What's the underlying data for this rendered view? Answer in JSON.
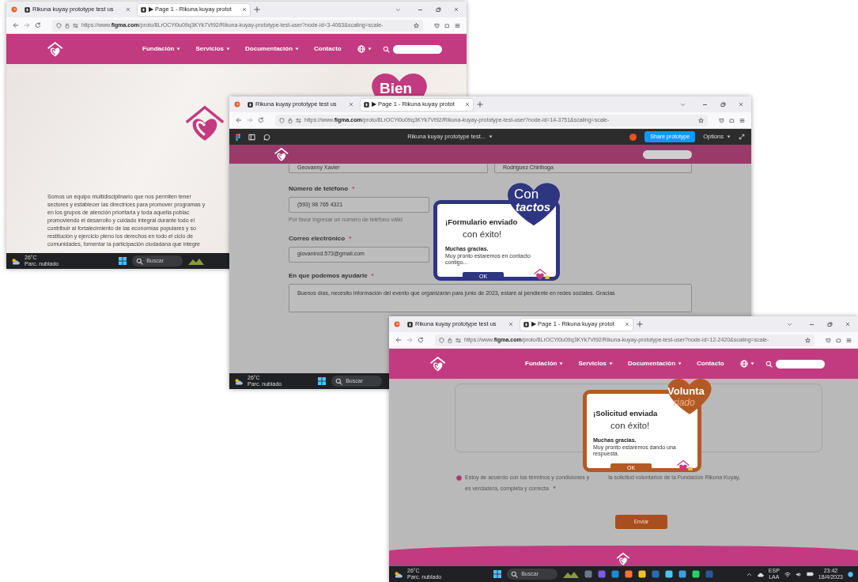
{
  "windows": [
    {
      "kind": "home",
      "tabs": [
        {
          "label": "Rikuna kuyay prototype test us",
          "selected": false
        },
        {
          "label": "▶ Page 1 - Rikuna kuyay protot",
          "selected": true
        }
      ],
      "url": "https://www.**figma.com**/proto/8LrOCYi0u09q3KYk7Vt92/Rikuna-kuyay-prototype-test-user?node-id=3-4063&scaling=scale-",
      "nav": [
        {
          "label": "Fundación",
          "dropdown": true
        },
        {
          "label": "Servicios",
          "dropdown": true
        },
        {
          "label": "Documentación",
          "dropdown": true
        },
        {
          "label": "Contacto",
          "dropdown": false
        }
      ],
      "hero": {
        "badge": "Bien",
        "paragraph": "Somos un equipo multidisciplinario que nos permiten tener\nsectores y establecer las directrices para promover programas y\nen los grupos de atención prioritaria y toda aquella poblac\npromoviendo el desarrollo y cuidado integral durante todo el\ncontribuir al fortalecimiento de las economías populares y so\nrestitución y ejercicio pleno los derechos en todo el ciclo de\ncomunidades, fomentar la participación ciudadana que integre"
      },
      "taskbar": {
        "temperature": "26°C",
        "weather": "Parc. nublado",
        "search": "Buscar"
      }
    },
    {
      "kind": "contact",
      "tabs": [
        {
          "label": "Rikuna kuyay prototype test us",
          "selected": false
        },
        {
          "label": "▶ Page 1 - Rikuna kuyay protot",
          "selected": true
        }
      ],
      "url": "https://www.**figma.com**/proto/8LrOCYi0u09q3KYk7Vt92/Rikuna-kuyay-prototype-test-user?node-id=14-3751&scaling=scale-",
      "figma_bar": {
        "title": "Rikuna kuyay prototype test...",
        "share": "Share prototype",
        "options": "Options"
      },
      "form": {
        "first_name": "Geovanny Xavier",
        "last_name": "Rodriguez Chiriboga",
        "fields": [
          {
            "kind": "input",
            "label": "Número de teléfono",
            "required_mark": "*",
            "value": "(593) 98 765 4321",
            "hint": "Por favor ingresar un número de teléfono válid"
          },
          {
            "kind": "input",
            "label": "Correo electrónico",
            "required_mark": "*",
            "value": "giovanirod.573@gmail.com"
          },
          {
            "kind": "textarea",
            "label": "En que podemos ayudarle",
            "required_mark": "*",
            "value": "Buenos días, necesito información del evento que organizarán para junio de 2023, estaré al pendiente en redes sociales. Gracias"
          }
        ]
      },
      "dialog": {
        "badge": [
          "Con",
          "tactos"
        ],
        "title": "¡Formulario enviado",
        "subtitle": "con éxito!",
        "thanks": "Muchas gracias.",
        "message": "Muy pronto estaremos en contacto contigo...",
        "button": "OK",
        "color": "#2e3581"
      },
      "taskbar": {
        "temperature": "26°C",
        "weather": "Parc. nublado",
        "search": "Buscar"
      }
    },
    {
      "kind": "volunteer",
      "tabs": [
        {
          "label": "Rikuna kuyay prototype test us",
          "selected": false
        },
        {
          "label": "▶ Page 1 - Rikuna kuyay protot",
          "selected": true
        }
      ],
      "url": "https://www.**figma.com**/proto/8LrOCYi0u09q3KYk7Vt92/Rikuna-kuyay-prototype-test-user?node-id=12-2420&scaling=scale-",
      "nav": [
        {
          "label": "Fundación",
          "dropdown": true
        },
        {
          "label": "Servicios",
          "dropdown": true
        },
        {
          "label": "Documentación",
          "dropdown": true
        },
        {
          "label": "Contacto",
          "dropdown": false
        }
      ],
      "dialog": {
        "badge": [
          "Volunta",
          "riado"
        ],
        "title": "¡Solicitud enviada",
        "subtitle": "con éxito!",
        "thanks": "Muchas gracias.",
        "message": "Muy pronto estaremos dando una respuesta.",
        "button": "OK",
        "color": "#b35a24"
      },
      "consent": {
        "checked": true,
        "text_before": "Estoy de acuerdo con los términos y condiciones y",
        "text_after": "la solicitud voluntarios de la Fundación Rikuna Kuyay,",
        "text_line2": "es verdadera, completa y correcta",
        "required_mark": "*"
      },
      "submit": "Enviar",
      "taskbar": {
        "temperature": "26°C",
        "weather": "Parc. nublado",
        "search": "Buscar",
        "language": "ESP",
        "region": "LAA",
        "time": "23:42",
        "date": "18/4/2023"
      }
    }
  ]
}
